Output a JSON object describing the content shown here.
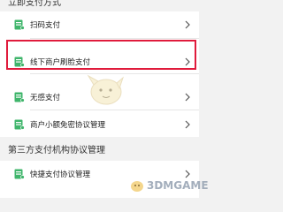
{
  "sections": [
    {
      "header": "立即支付方式",
      "items": [
        {
          "label": "扫码支付",
          "icon": "scan-pay-icon"
        },
        {
          "label": "线下商户刷脸支付",
          "icon": "face-pay-icon",
          "highlighted": true
        },
        {
          "label": "无感支付",
          "icon": "sensorless-pay-icon"
        },
        {
          "label": "商户小额免密协议管理",
          "icon": "small-amount-agreement-icon"
        }
      ]
    },
    {
      "header": "第三方支付机构协议管理",
      "items": [
        {
          "label": "快捷支付协议管理",
          "icon": "quick-pay-agreement-icon"
        }
      ]
    }
  ],
  "colors": {
    "icon_green": "#3fb56b",
    "highlight_red": "#e01b3c",
    "background": "#f2f2f2"
  },
  "watermark": "3DMGAME"
}
